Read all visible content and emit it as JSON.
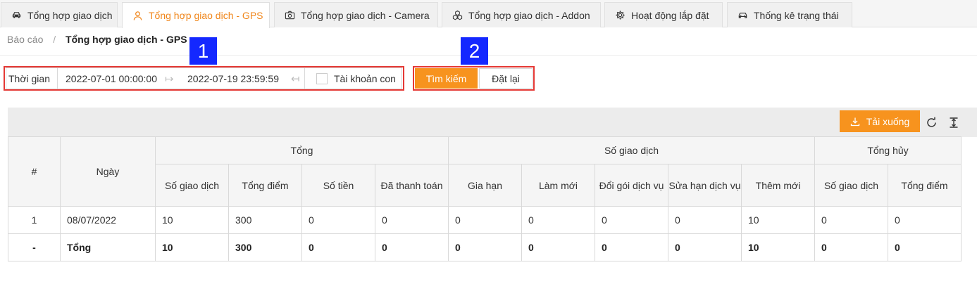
{
  "tabs": [
    {
      "label": "Tổng hợp giao dịch",
      "icon": "car-icon"
    },
    {
      "label": "Tổng hợp giao dịch - GPS",
      "icon": "user-icon"
    },
    {
      "label": "Tổng hợp giao dịch - Camera",
      "icon": "camera-icon"
    },
    {
      "label": "Tổng hợp giao dịch - Addon",
      "icon": "cubes-icon"
    },
    {
      "label": "Hoạt động lắp đặt",
      "icon": "gear-icon"
    },
    {
      "label": "Thống kê trạng thái",
      "icon": "car-icon"
    }
  ],
  "active_tab": 1,
  "breadcrumb": {
    "root": "Báo cáo",
    "separator": "/",
    "current": "Tổng hợp giao dịch - GPS"
  },
  "filter": {
    "time_label": "Thời gian",
    "start_date": "2022-07-01 00:00:00",
    "end_date": "2022-07-19 23:59:59",
    "sub_account_label": "Tài khoản con"
  },
  "buttons": {
    "search": "Tìm kiếm",
    "reset": "Đặt lại",
    "download": "Tải xuống"
  },
  "annotations": {
    "badge1": "1",
    "badge2": "2"
  },
  "colors": {
    "accent": "#f7931e",
    "highlight_border": "#e53935",
    "badge": "#1428ff"
  },
  "table": {
    "group_headers": {
      "index": "#",
      "date": "Ngày",
      "total": "Tổng",
      "transactions": "Số giao dịch",
      "cancelled": "Tổng hủy"
    },
    "sub_headers": [
      "Số giao dịch",
      "Tổng điểm",
      "Số tiền",
      "Đã thanh toán",
      "Gia hạn",
      "Làm mới",
      "Đổi gói dịch vụ",
      "Sửa hạn dịch vụ",
      "Thêm mới",
      "Số giao dịch",
      "Tổng điểm"
    ],
    "rows": [
      {
        "index": "1",
        "date": "08/07/2022",
        "cells": [
          "10",
          "300",
          "0",
          "0",
          "0",
          "0",
          "0",
          "0",
          "10",
          "0",
          "0"
        ]
      }
    ],
    "total_row": {
      "index": "-",
      "date": "Tổng",
      "cells": [
        "10",
        "300",
        "0",
        "0",
        "0",
        "0",
        "0",
        "0",
        "10",
        "0",
        "0"
      ]
    }
  }
}
